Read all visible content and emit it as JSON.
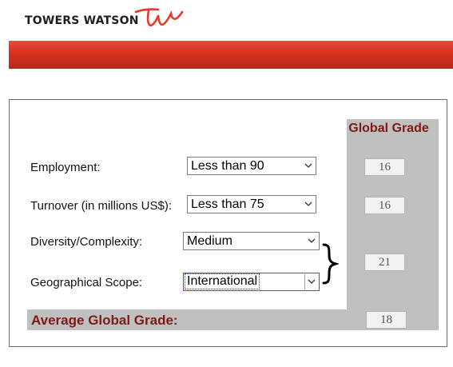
{
  "brand": {
    "name": "TOWERS WATSON",
    "logo_icon": "tw-script-logo-icon",
    "accent_color": "#e53a2c"
  },
  "banner": {
    "color": "#d6321f"
  },
  "panel": {
    "grade_header": "Global Grade",
    "label_color": "#7b1a18",
    "rows": [
      {
        "label": "Employment:",
        "selected": "Less than 90",
        "grade": "16"
      },
      {
        "label": "Turnover (in millions US$):",
        "selected": "Less than 75",
        "grade": "16"
      },
      {
        "label": "Diversity/Complexity:",
        "selected": "Medium"
      },
      {
        "label": "Geographical Scope:",
        "selected": "International"
      }
    ],
    "combined_grade": "21",
    "average_label": "Average Global Grade:",
    "average_grade": "18"
  }
}
